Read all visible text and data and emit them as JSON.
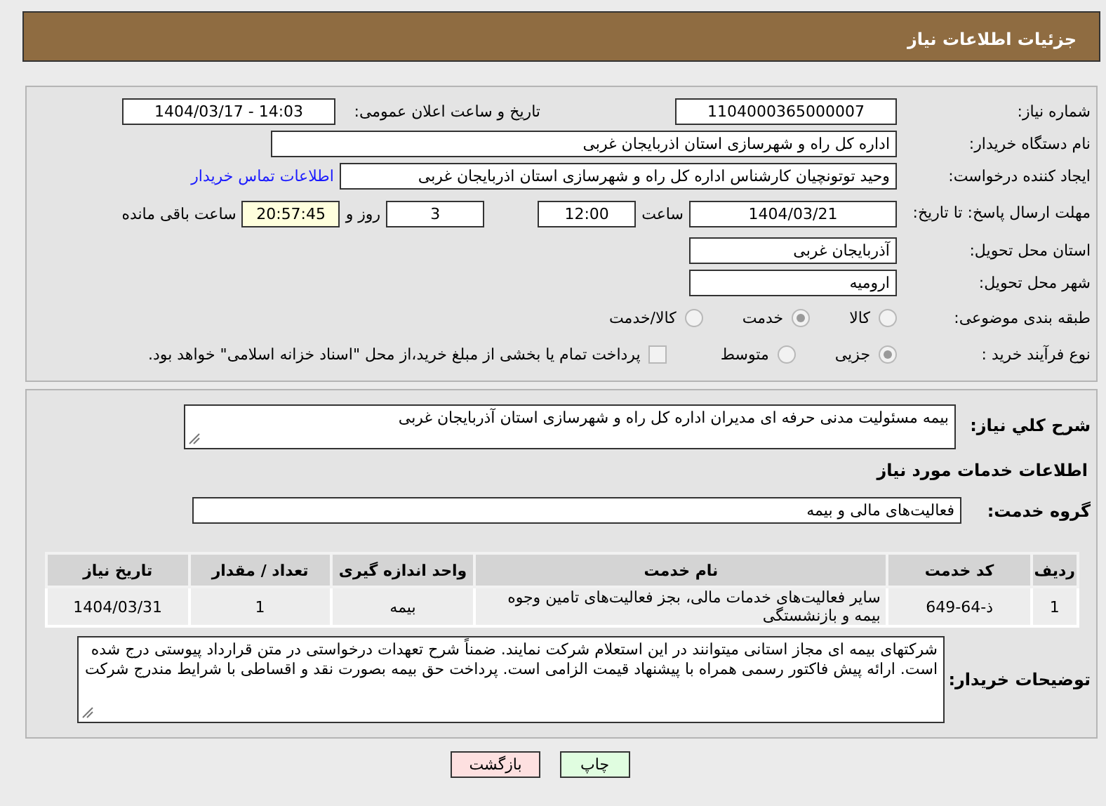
{
  "header": {
    "title": "جزئیات اطلاعات نیاز"
  },
  "details": {
    "need_number": {
      "label": "شماره نیاز:",
      "value": "1104000365000007"
    },
    "announce": {
      "label": "تاریخ و ساعت اعلان عمومی:",
      "value": "1404/03/17 - 14:03"
    },
    "buyer_org": {
      "label": "نام دستگاه خریدار:",
      "value": "اداره کل راه و شهرسازی استان اذربایجان غربی"
    },
    "requester": {
      "label": "ایجاد کننده درخواست:",
      "value": "وحید توتونچیان کارشناس اداره کل راه و شهرسازی استان اذربایجان غربی",
      "link": "اطلاعات تماس خریدار"
    },
    "deadline": {
      "label": "مهلت ارسال پاسخ: تا تاریخ:",
      "date": "1404/03/21",
      "time_label": "ساعت",
      "time": "12:00",
      "days": "3",
      "days_label": "روز و",
      "remaining": "20:57:45",
      "remaining_label": "ساعت باقی مانده"
    },
    "province": {
      "label": "استان محل تحویل:",
      "value": "آذربایجان غربی"
    },
    "city": {
      "label": "شهر محل تحویل:",
      "value": "ارومیه"
    },
    "category": {
      "label": "طبقه بندی موضوعی:",
      "options": [
        {
          "label": "کالا",
          "selected": false
        },
        {
          "label": "خدمت",
          "selected": true
        },
        {
          "label": "کالا/خدمت",
          "selected": false
        }
      ]
    },
    "process": {
      "label": "نوع فرآیند خرید :",
      "options": [
        {
          "label": "جزیی",
          "selected": true
        },
        {
          "label": "متوسط",
          "selected": false
        }
      ],
      "payment": {
        "label": "پرداخت تمام یا بخشی از مبلغ خرید،از محل \"اسناد خزانه اسلامی\" خواهد بود.",
        "checked": false
      }
    }
  },
  "services": {
    "summary": {
      "label": "شرح کلي نیاز:",
      "value": "بیمه مسئولیت مدنی حرفه ای مدیران اداره کل راه و شهرسازی استان آذربایجان غربی"
    },
    "heading": "اطلاعات خدمات مورد نیاز",
    "group": {
      "label": "گروه خدمت:",
      "value": "فعالیت‌های مالی و بیمه"
    },
    "table": {
      "columns": [
        "ردیف",
        "کد خدمت",
        "نام خدمت",
        "واحد اندازه گیری",
        "تعداد / مقدار",
        "تاریخ نیاز"
      ],
      "rows": [
        [
          "1",
          "ذ-64-649",
          "سایر فعالیت‌های خدمات مالی، بجز فعالیت‌های تامین وجوه بیمه و بازنشستگی",
          "بیمه",
          "1",
          "1404/03/31"
        ]
      ]
    },
    "buyer_notes": {
      "label": "توضیحات خریدار:",
      "value": "شرکتهای بیمه ای مجاز استانی میتوانند در این استعلام شرکت نمایند. ضمناً شرح تعهدات درخواستی در متن قرارداد پیوستی درج شده است. ارائه پیش فاکتور رسمی همراه با پیشنهاد قیمت الزامی است. پرداخت حق بیمه بصورت نقد و اقساطی با شرایط مندرج شرکت"
    }
  },
  "buttons": [
    {
      "label": "چاپ",
      "kind": "print"
    },
    {
      "label": "بازگشت",
      "kind": "back"
    }
  ]
}
